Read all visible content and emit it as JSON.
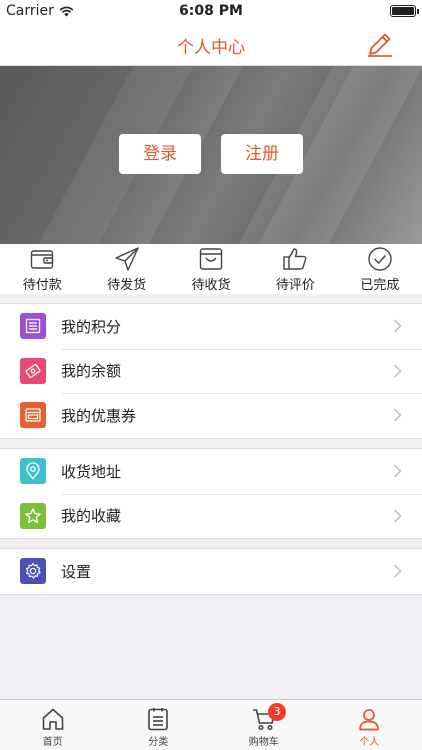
{
  "status_bar": {
    "carrier": "Carrier",
    "time": "6:08 PM"
  },
  "header": {
    "title": "个人中心"
  },
  "banner": {
    "login_label": "登录",
    "register_label": "注册"
  },
  "order_status": [
    {
      "label": "待付款",
      "icon": "wallet-icon"
    },
    {
      "label": "待发货",
      "icon": "paper-plane-icon"
    },
    {
      "label": "待收货",
      "icon": "package-icon"
    },
    {
      "label": "待评价",
      "icon": "thumbs-up-icon"
    },
    {
      "label": "已完成",
      "icon": "check-circle-icon"
    }
  ],
  "menu_groups": [
    [
      {
        "label": "我的积分",
        "icon": "points-icon",
        "color": "#9b4fd6"
      },
      {
        "label": "我的余额",
        "icon": "balance-icon",
        "color": "#e84a73"
      },
      {
        "label": "我的优惠券",
        "icon": "coupon-icon",
        "color": "#e8602c"
      }
    ],
    [
      {
        "label": "收货地址",
        "icon": "location-icon",
        "color": "#3fbfd0"
      },
      {
        "label": "我的收藏",
        "icon": "star-icon",
        "color": "#7cbf3a"
      }
    ],
    [
      {
        "label": "设置",
        "icon": "gear-icon",
        "color": "#4b4fb8"
      }
    ]
  ],
  "tab_bar": [
    {
      "label": "首页",
      "icon": "home-icon"
    },
    {
      "label": "分类",
      "icon": "clipboard-icon"
    },
    {
      "label": "购物车",
      "icon": "cart-icon",
      "badge": "3"
    },
    {
      "label": "个人",
      "icon": "person-icon",
      "active": true
    }
  ],
  "colors": {
    "accent": "#e05a2b",
    "badge": "#f03c2c"
  }
}
